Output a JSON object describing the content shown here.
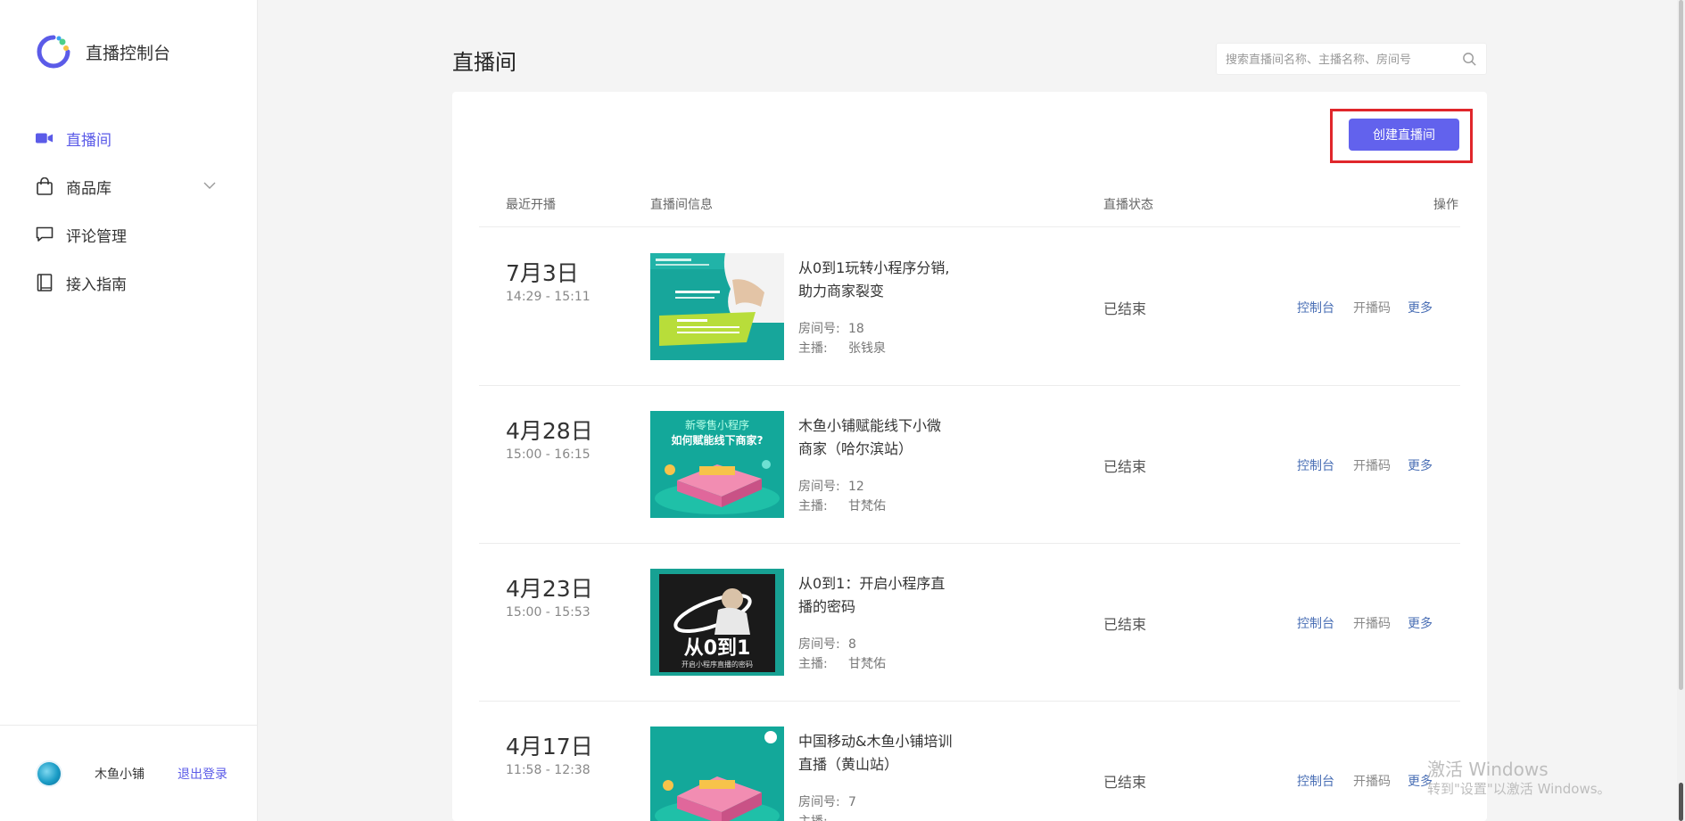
{
  "sidebar": {
    "app_title": "直播控制台",
    "items": [
      {
        "label": "直播间",
        "icon": "video-camera-icon"
      },
      {
        "label": "商品库",
        "icon": "shopping-bag-icon"
      },
      {
        "label": "评论管理",
        "icon": "comment-icon"
      },
      {
        "label": "接入指南",
        "icon": "book-icon"
      }
    ],
    "footer": {
      "shop_name": "木鱼小铺",
      "logout": "退出登录"
    }
  },
  "header": {
    "title": "直播间",
    "search_placeholder": "搜索直播间名称、主播名称、房间号"
  },
  "create_button": "创建直播间",
  "table": {
    "columns": [
      "最近开播",
      "直播间信息",
      "直播状态",
      "操作"
    ],
    "room_label": "房间号:",
    "anchor_label": "主播:",
    "actions": {
      "console": "控制台",
      "code": "开播码",
      "more": "更多"
    },
    "rows": [
      {
        "date": "7月3日",
        "time": "14:29 - 15:11",
        "title": "从0到1玩转小程序分销,助力商家裂变",
        "room": "18",
        "anchor": "张钱泉",
        "status": "已结束"
      },
      {
        "date": "4月28日",
        "time": "15:00 - 16:15",
        "title": "木鱼小铺赋能线下小微商家（哈尔滨站）",
        "room": "12",
        "anchor": "甘梵佑",
        "status": "已结束"
      },
      {
        "date": "4月23日",
        "time": "15:00 - 15:53",
        "title": "从0到1：开启小程序直播的密码",
        "room": "8",
        "anchor": "甘梵佑",
        "status": "已结束"
      },
      {
        "date": "4月17日",
        "time": "11:58 - 12:38",
        "title": "中国移动&木鱼小铺培训直播（黄山站）",
        "room": "7",
        "anchor": "",
        "status": "已结束"
      }
    ]
  },
  "thumbnails": {
    "t2_line1": "新零售小程序",
    "t2_line2": "如何赋能线下商家?",
    "t3_big": "从0到1",
    "t3_small": "开启小程序直播的密码"
  },
  "watermark": {
    "line1": "激活 Windows",
    "line2": "转到\"设置\"以激活 Windows。"
  },
  "colors": {
    "accent": "#6262ed",
    "highlight_border": "#e0262b",
    "link": "#4a6fb5"
  }
}
